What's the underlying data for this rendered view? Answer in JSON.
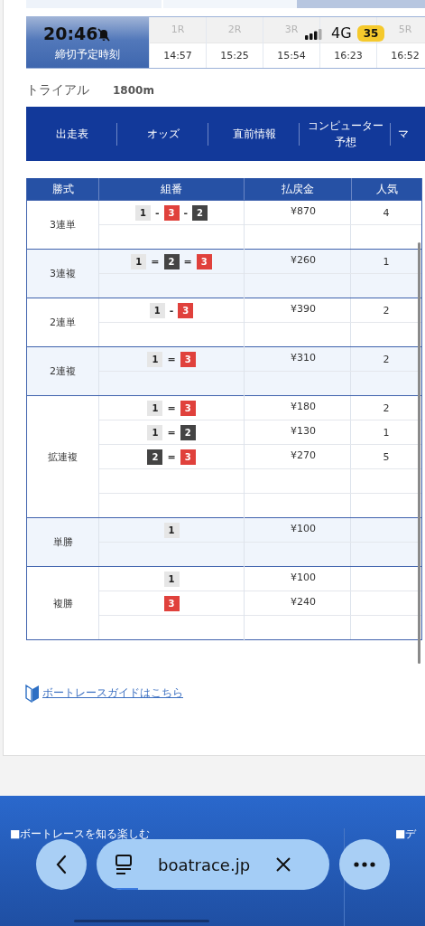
{
  "status_bar": {
    "time": "20:46",
    "network": "4G",
    "battery": "35"
  },
  "race_times": {
    "label": "締切予定時刻",
    "races": [
      {
        "race": "1R",
        "time": "14:57"
      },
      {
        "race": "2R",
        "time": "15:25"
      },
      {
        "race": "3R",
        "time": "15:54"
      },
      {
        "time": "16:23"
      },
      {
        "race": "5R",
        "time": "16:52"
      }
    ]
  },
  "race_info": {
    "name": "トライアル",
    "distance": "1800m"
  },
  "nav_tabs": [
    {
      "label": "出走表"
    },
    {
      "label": "オッズ"
    },
    {
      "label": "直前情報"
    },
    {
      "label": "コンピューター",
      "sublabel": "予想"
    },
    {
      "label": "マ"
    }
  ],
  "payout_table": {
    "columns": [
      "勝式",
      "組番",
      "払戻金",
      "人気"
    ],
    "groups": [
      {
        "bet_type": "3連単",
        "rows": [
          {
            "separator": "-",
            "boats": [
              {
                "number": "1",
                "color": "#e6e6e6"
              },
              {
                "number": "3",
                "color": "#e0413c"
              },
              {
                "number": "2",
                "color": "#444444"
              }
            ],
            "payout": "¥870",
            "popularity": "4"
          }
        ]
      },
      {
        "bet_type": "3連複",
        "rows": [
          {
            "separator": "=",
            "boats": [
              {
                "number": "1",
                "color": "#e6e6e6"
              },
              {
                "number": "2",
                "color": "#444444"
              },
              {
                "number": "3",
                "color": "#e0413c"
              }
            ],
            "payout": "¥260",
            "popularity": "1"
          }
        ]
      },
      {
        "bet_type": "2連単",
        "rows": [
          {
            "separator": "-",
            "boats": [
              {
                "number": "1",
                "color": "#e6e6e6"
              },
              {
                "number": "3",
                "color": "#e0413c"
              }
            ],
            "payout": "¥390",
            "popularity": "2"
          }
        ]
      },
      {
        "bet_type": "2連複",
        "rows": [
          {
            "separator": "=",
            "boats": [
              {
                "number": "1",
                "color": "#e6e6e6"
              },
              {
                "number": "3",
                "color": "#e0413c"
              }
            ],
            "payout": "¥310",
            "popularity": "2"
          }
        ]
      },
      {
        "bet_type": "拡連複",
        "rows": [
          {
            "separator": "=",
            "boats": [
              {
                "number": "1",
                "color": "#e6e6e6"
              },
              {
                "number": "3",
                "color": "#e0413c"
              }
            ],
            "payout": "¥180",
            "popularity": "2"
          },
          {
            "separator": "=",
            "boats": [
              {
                "number": "1",
                "color": "#e6e6e6"
              },
              {
                "number": "2",
                "color": "#444444"
              }
            ],
            "payout": "¥130",
            "popularity": "1"
          },
          {
            "separator": "=",
            "boats": [
              {
                "number": "2",
                "color": "#444444"
              },
              {
                "number": "3",
                "color": "#e0413c"
              }
            ],
            "payout": "¥270",
            "popularity": "5"
          }
        ]
      },
      {
        "bet_type": "単勝",
        "rows": [
          {
            "boats": [
              {
                "number": "1",
                "color": "#e6e6e6"
              }
            ],
            "payout": "¥100"
          }
        ]
      },
      {
        "bet_type": "複勝",
        "rows": [
          {
            "boats": [
              {
                "number": "1",
                "color": "#e6e6e6"
              }
            ],
            "payout": "¥100"
          },
          {
            "boats": [
              {
                "number": "3",
                "color": "#e0413c"
              }
            ],
            "payout": "¥240"
          }
        ]
      }
    ]
  },
  "guide_link": "ボートレースガイドはこちら",
  "footer": {
    "headings": [
      "■ボートレースを知る楽しむ",
      "■デ"
    ]
  },
  "browser_bar": {
    "url": "boatrace.jp",
    "loading": {
      "level": 0.18
    }
  }
}
